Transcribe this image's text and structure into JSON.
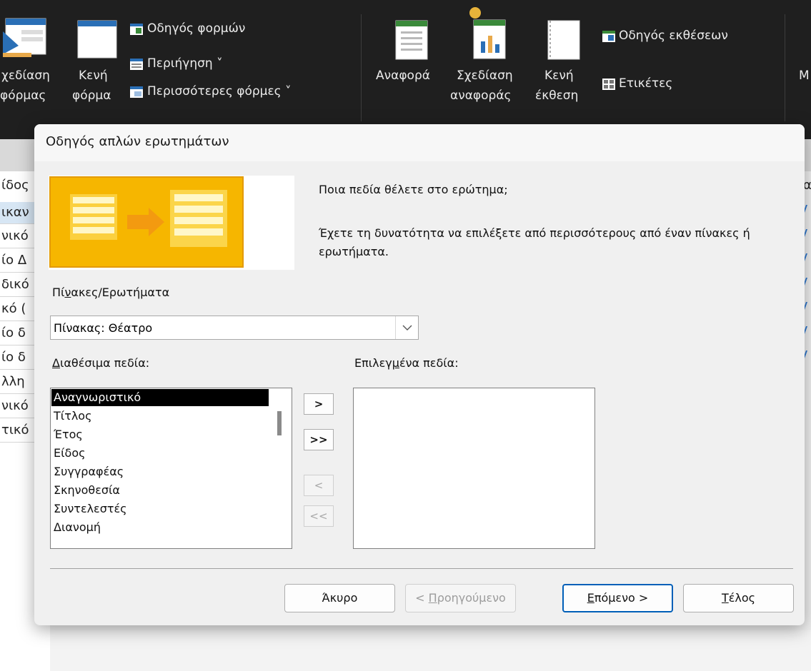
{
  "ribbon": {
    "form_design_l1": "χεδίαση",
    "form_design_l2": "φόρμας",
    "blank_form_l1": "Κενή",
    "blank_form_l2": "φόρμα",
    "form_wizard": "Οδηγός φορμών",
    "navigation": "Περιήγηση ˅",
    "more_forms": "Περισσότερες φόρμες ˅",
    "report": "Αναφορά",
    "report_design_l1": "Σχεδίαση",
    "report_design_l2": "αναφοράς",
    "blank_report_l1": "Κενή",
    "blank_report_l2": "έκθεση",
    "report_wizard": "Οδηγός εκθέσεων",
    "labels": "Ετικέτες",
    "macro_partial": "M"
  },
  "sheet": {
    "header_partial": "ίδος",
    "right_header_partial": "α",
    "rows": [
      "ικαν",
      "νικό",
      "ίο Δ",
      "δικό",
      "κό (",
      "ίο δ",
      "ίο δ",
      "λλη",
      "νικό",
      "τικό"
    ]
  },
  "dialog": {
    "title": "Οδηγός απλών ερωτημάτων",
    "question": "Ποια πεδία θέλετε στο ερώτημα;",
    "hint_line1": "Έχετε τη δυνατότητα να επιλέξετε από περισσότερους από έναν πίνακες ή",
    "hint_line2": "ερωτήματα.",
    "tables_label_pre": "Πί",
    "tables_label_u": "ν",
    "tables_label_post": "ακες/Ερωτήματα",
    "table_selected": "Πίνακας: Θέατρο",
    "available_label_u": "Δ",
    "available_label_post": "ιαθέσιμα πεδία:",
    "selected_label_pre": "Επιλεγ",
    "selected_label_u": "μ",
    "selected_label_post": "ένα πεδία:",
    "available_fields": [
      "Αναγνωριστικό",
      "Τίτλος",
      "Έτος",
      "Είδος",
      "Συγγραφέας",
      "Σκηνοθεσία",
      "Συντελεστές",
      "Διανομή"
    ],
    "selected_fields": [],
    "add_one": ">",
    "add_all": ">>",
    "remove_one": "<",
    "remove_all": "<<",
    "cancel": "Άκυρο",
    "back_pre": "< ",
    "back_u": "Π",
    "back_post": "ροηγούμενο",
    "next_u": "Ε",
    "next_post": "πόμενο >",
    "finish_u": "Τ",
    "finish_post": "έλος"
  },
  "colors": {
    "accent": "#005fb8",
    "ribbon_bg": "#1f1f1f",
    "selection": "#000000"
  }
}
